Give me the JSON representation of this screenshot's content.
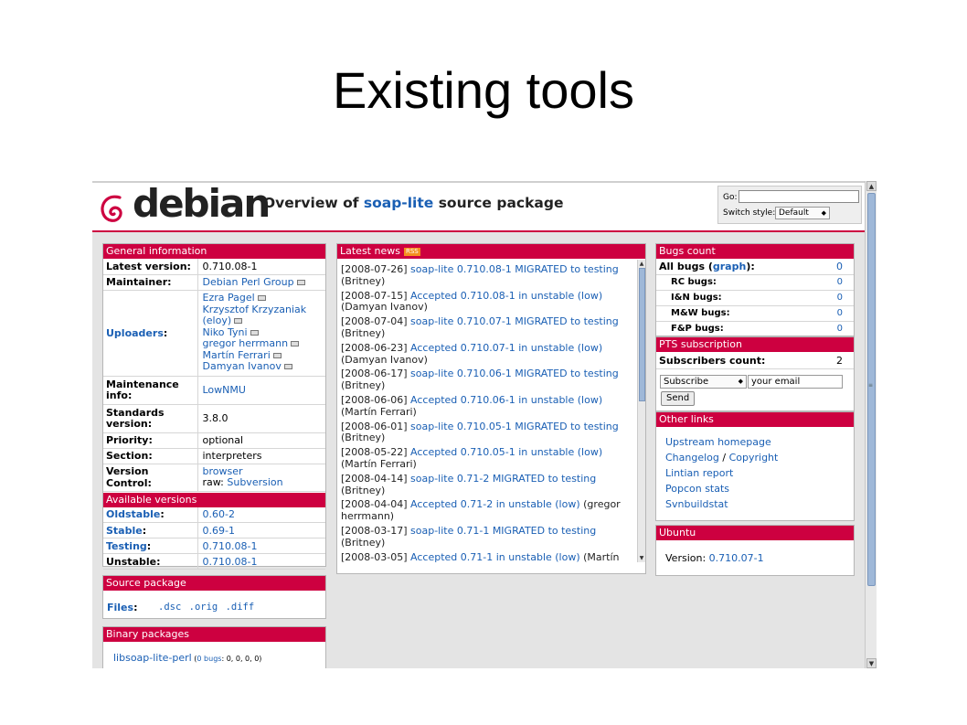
{
  "slide": {
    "title": "Existing tools"
  },
  "header": {
    "logo_text": "debian",
    "heading_prefix": "Overview of ",
    "heading_pkg": "soap-lite",
    "heading_suffix": " source package",
    "go_label": "Go:",
    "switch_label": "Switch style:",
    "switch_value": "Default"
  },
  "general": {
    "title": "General information",
    "latest_version_label": "Latest version:",
    "latest_version": "0.710.08-1",
    "maintainer_label": "Maintainer:",
    "maintainer": "Debian Perl Group",
    "uploaders_label": "Uploaders",
    "uploaders_colon": ":",
    "uploaders": [
      "Ezra Pagel",
      "Krzysztof Krzyzaniak",
      "(eloy)",
      "Niko Tyni",
      "gregor herrmann",
      "Martín Ferrari",
      "Damyan Ivanov"
    ],
    "maintenance_label_1": "Maintenance",
    "maintenance_label_2": "info:",
    "maintenance": "LowNMU",
    "standards_label_1": "Standards",
    "standards_label_2": "version:",
    "standards": "3.8.0",
    "priority_label": "Priority:",
    "priority": "optional",
    "section_label": "Section:",
    "section": "interpreters",
    "vcs_label": "Version Control:",
    "vcs_browser": "browser",
    "vcs_raw_prefix": "raw: ",
    "vcs_raw": "Subversion"
  },
  "versions": {
    "title": "Available versions",
    "oldstable_label": "Oldstable",
    "oldstable": "0.60-2",
    "stable_label": "Stable",
    "stable": "0.69-1",
    "testing_label": "Testing",
    "testing": "0.710.08-1",
    "unstable_label": "Unstable:",
    "unstable": "0.710.08-1",
    "colon": ":"
  },
  "source": {
    "title": "Source package",
    "files_label": "Files",
    "colon": ":",
    "dsc": ".dsc",
    "orig": ".orig",
    "diff": ".diff"
  },
  "binary": {
    "title": "Binary packages",
    "pkg": "libsoap-lite-perl",
    "bugs_open": " (",
    "bugs_link": "0 bugs",
    "bugs_rest": ": 0, 0, 0, 0)"
  },
  "news": {
    "title": "Latest news",
    "rss": "RSS",
    "items": [
      {
        "date": "[2008-07-26] ",
        "text": "soap-lite 0.710.08-1 MIGRATED to testing",
        "by": "(Britney)"
      },
      {
        "date": "[2008-07-15] ",
        "text": "Accepted 0.710.08-1 in unstable (low)",
        "by": "(Damyan Ivanov)"
      },
      {
        "date": "[2008-07-04] ",
        "text": "soap-lite 0.710.07-1 MIGRATED to testing",
        "by": "(Britney)"
      },
      {
        "date": "[2008-06-23] ",
        "text": "Accepted 0.710.07-1 in unstable (low)",
        "by": "(Damyan Ivanov)"
      },
      {
        "date": "[2008-06-17] ",
        "text": "soap-lite 0.710.06-1 MIGRATED to testing",
        "by": "(Britney)"
      },
      {
        "date": "[2008-06-06] ",
        "text": "Accepted 0.710.06-1 in unstable (low)",
        "by": "(Martín Ferrari)"
      },
      {
        "date": "[2008-06-01] ",
        "text": "soap-lite 0.710.05-1 MIGRATED to testing",
        "by": "(Britney)"
      },
      {
        "date": "[2008-05-22] ",
        "text": "Accepted 0.710.05-1 in unstable (low)",
        "by": "(Martín Ferrari)"
      },
      {
        "date": "[2008-04-14] ",
        "text": "soap-lite 0.71-2 MIGRATED to testing",
        "by": "(Britney)"
      },
      {
        "date": "[2008-04-04] ",
        "text": "Accepted 0.71-2 in unstable (low)",
        "by": "(gregor herrmann)"
      },
      {
        "date": "[2008-03-17] ",
        "text": "soap-lite 0.71-1 MIGRATED to testing",
        "by": "(Britney)"
      },
      {
        "date": "[2008-03-05] ",
        "text": "Accepted 0.71-1 in unstable (low)",
        "by": "(Martín"
      }
    ]
  },
  "bugs": {
    "title": "Bugs count",
    "all_label": "All bugs (",
    "graph": "graph",
    "all_close": "):",
    "all": "0",
    "rc_label": "RC bugs:",
    "rc": "0",
    "in_label": "I&N bugs:",
    "in": "0",
    "mw_label": "M&W bugs:",
    "mw": "0",
    "fp_label": "F&P bugs:",
    "fp": "0"
  },
  "pts": {
    "title": "PTS subscription",
    "subs_label": "Subscribers count:",
    "subs": "2",
    "action": "Subscribe",
    "email_value": "your email",
    "send": "Send"
  },
  "other": {
    "title": "Other links",
    "upstream": "Upstream homepage",
    "changelog": "Changelog",
    "slash": " / ",
    "copyright": "Copyright",
    "lintian": "Lintian report",
    "popcon": "Popcon stats",
    "svnbuild": "Svnbuildstat"
  },
  "ubuntu": {
    "title": "Ubuntu",
    "version_label": "Version: ",
    "version": "0.710.07-1"
  },
  "colors": {
    "accent": "#cd0040",
    "link": "#1a5fb4"
  }
}
